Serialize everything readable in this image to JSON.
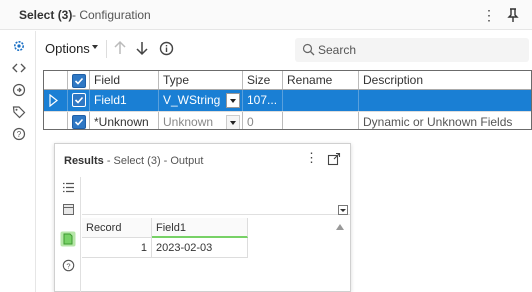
{
  "window": {
    "title_main": "Select (3)",
    "title_sub": "- Configuration"
  },
  "toolbar": {
    "options_label": "Options",
    "search_placeholder": "Search"
  },
  "grid": {
    "columns": [
      "Field",
      "Type",
      "Size",
      "Rename",
      "Description"
    ],
    "rows": [
      {
        "selected": true,
        "checked": true,
        "field": "Field1",
        "type": "V_WString",
        "size": "107...",
        "rename": "",
        "description": ""
      },
      {
        "selected": false,
        "checked": true,
        "field": "*Unknown",
        "type": "Unknown",
        "size": "0",
        "rename": "",
        "description": "Dynamic or Unknown Fields"
      }
    ]
  },
  "output": {
    "title_main": "Results",
    "title_sub": "- Select (3) - Output",
    "columns": [
      "Record",
      "Field1"
    ],
    "rows": [
      {
        "record": "1",
        "field1": "2023-02-03"
      }
    ]
  },
  "colors": {
    "selection": "#1a7fd4",
    "checkbox": "#2f78c4",
    "accent_green": "#77d166"
  },
  "icons": {
    "rail": [
      "gear-icon",
      "code-icon",
      "refresh-icon",
      "tag-icon",
      "help-icon"
    ],
    "toolbar": [
      "arrow-up-icon",
      "arrow-down-icon",
      "info-icon",
      "search-icon"
    ],
    "output_rail": [
      "list-icon",
      "table-icon",
      "data-icon",
      "help-icon"
    ]
  }
}
